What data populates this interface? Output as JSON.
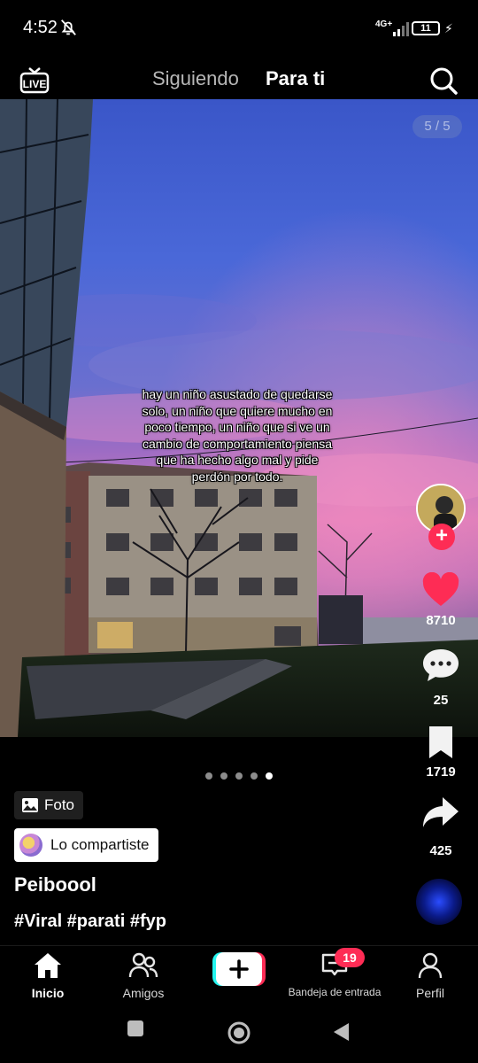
{
  "status_bar": {
    "time": "4:52",
    "network": "4G+",
    "battery": "11"
  },
  "top_nav": {
    "tabs": [
      {
        "label": "Siguiendo",
        "active": false
      },
      {
        "label": "Para ti",
        "active": true
      }
    ]
  },
  "post": {
    "page_counter": "5 / 5",
    "caption": "hay un niño asustado de quedarse solo, un niño que quiere mucho en poco tiempo, un niño que si ve un cambio de comportamiento piensa que ha hecho algo mal y pide perdón por todo.",
    "type_chip": "Foto",
    "shared_chip": "Lo compartiste",
    "username": "Peiboool",
    "hashtags": "#Viral #parati #fyp",
    "slides_total": 5,
    "slide_active": 5
  },
  "actions": {
    "likes": "8710",
    "comments": "25",
    "saves": "1719",
    "shares": "425"
  },
  "bottom_nav": {
    "home": "Inicio",
    "friends": "Amigos",
    "inbox": "Bandeja de entrada",
    "inbox_badge": "19",
    "profile": "Perfil"
  },
  "colors": {
    "accent": "#fe2c55",
    "create_cyan": "#25f4ee",
    "background": "#000000"
  },
  "icons": [
    "live-icon",
    "search-icon",
    "heart-icon",
    "comment-icon",
    "bookmark-icon",
    "share-icon",
    "home-icon",
    "friends-icon",
    "plus-icon",
    "inbox-icon",
    "profile-icon",
    "photo-icon",
    "bell-off-icon"
  ]
}
